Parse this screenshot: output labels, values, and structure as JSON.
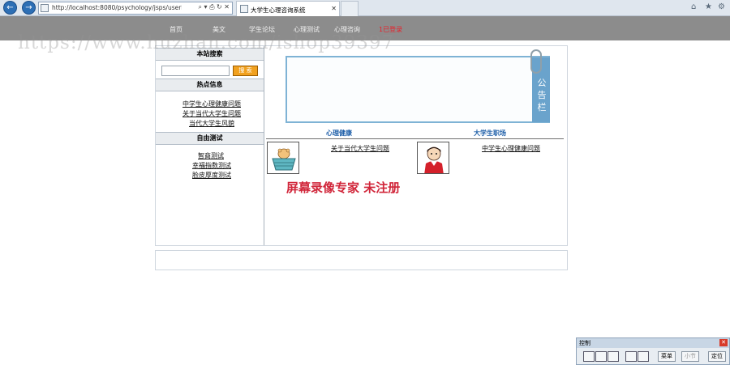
{
  "browser": {
    "address": "http://localhost:8080/psychology/jsps/userk",
    "address_tools": "⌕ ▾ ⎙ ↻ ✕",
    "tab_title": "大学生心理咨询系统",
    "tab_close": "✕",
    "back_glyph": "←",
    "forward_glyph": "→",
    "home_glyph": "⌂",
    "star_glyph": "★",
    "settings_glyph": "⚙"
  },
  "nav": {
    "items": [
      {
        "label": "首页"
      },
      {
        "label": "美文"
      },
      {
        "label": "学生论坛"
      },
      {
        "label": "心理测试"
      },
      {
        "label": "心理咨询"
      },
      {
        "label": "1已登录"
      }
    ]
  },
  "watermark": "https://www.huzhan.com/ishop39397",
  "sidebar": {
    "search_title": "本站搜索",
    "search_button": "搜 索",
    "hot_title": "热点信息",
    "hot_links": [
      "中学生心理健康问题",
      "关于当代大学生问题",
      "当代大学生风貌"
    ],
    "test_title": "自由测试",
    "test_links": [
      "智商测试",
      "幸福指数测试",
      "脸皮厚度测试"
    ]
  },
  "notice": {
    "label": "公告栏"
  },
  "content": {
    "col1_title": "心理健康",
    "col1_link": "关于当代大学生问题",
    "col2_title": "大学生职场",
    "col2_link": "中学生心理健康问题",
    "stamp": "屏幕录像专家  未注册"
  },
  "control_panel": {
    "title": "控制",
    "close": "✕",
    "menu": "菜单",
    "step": "小节",
    "locate": "定位"
  },
  "colors": {
    "nav_bg": "#8c8c8c",
    "login_red": "#e8202a",
    "notice_blue": "#6aa3cc",
    "search_orange": "#f1a11f",
    "stamp_red": "#d1263a"
  }
}
